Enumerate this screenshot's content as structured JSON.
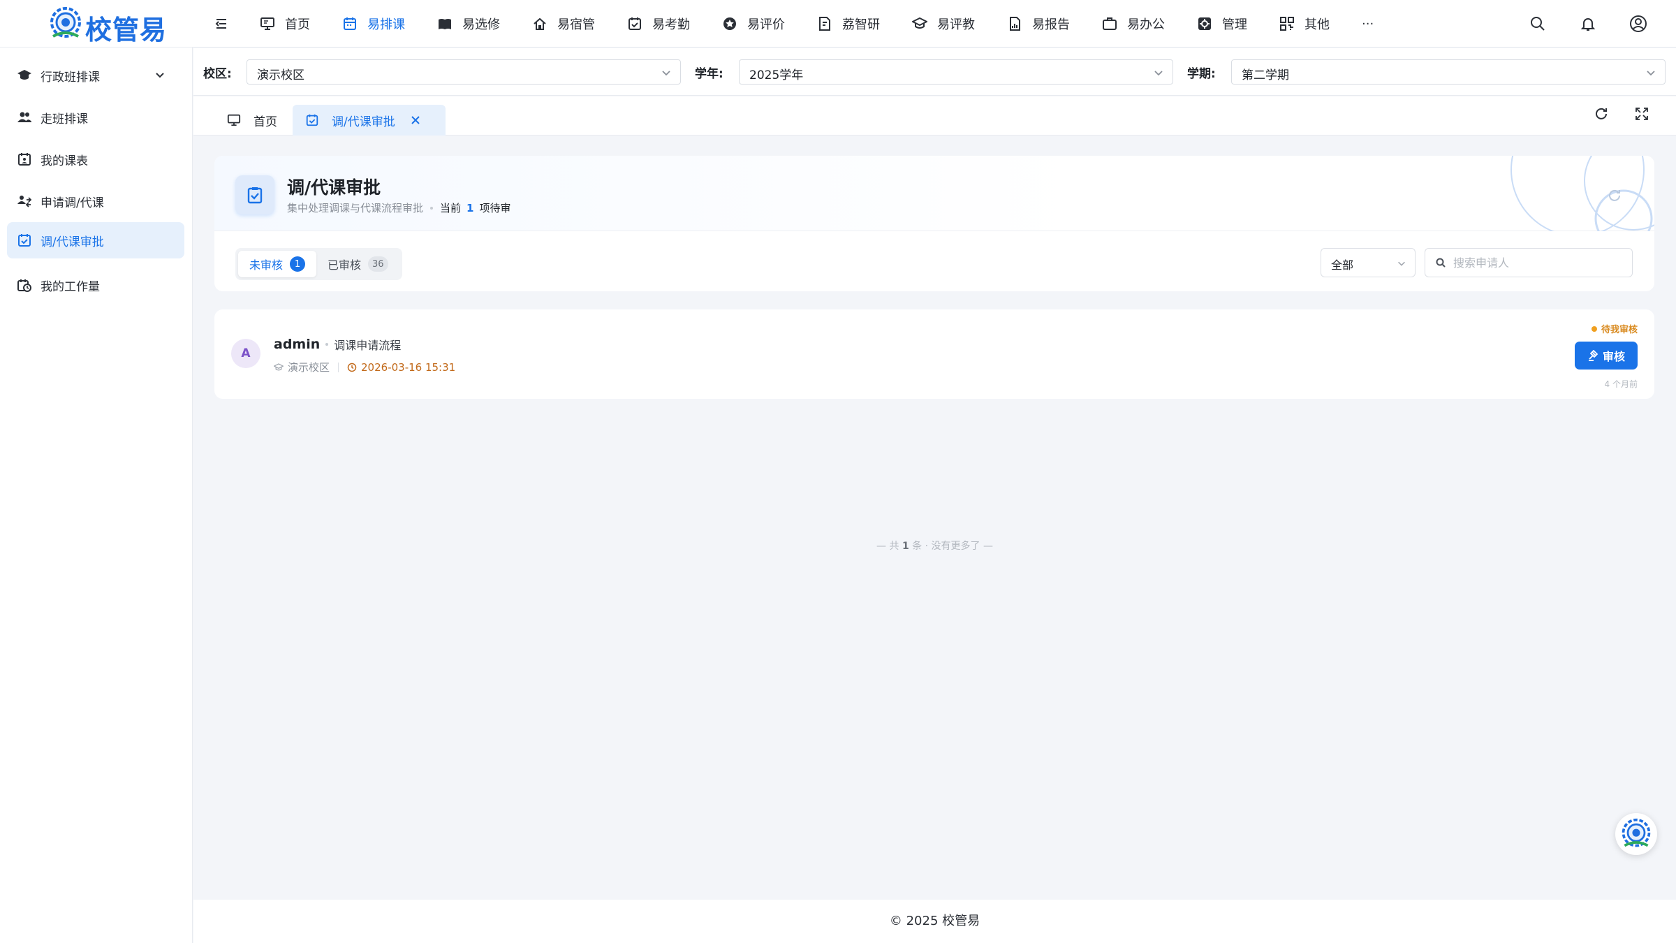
{
  "app": {
    "logo_text": "校管易"
  },
  "topnav": [
    {
      "label": "首页",
      "icon": "monitor-icon"
    },
    {
      "label": "易排课",
      "icon": "calendar-icon",
      "active": true
    },
    {
      "label": "易选修",
      "icon": "book-icon"
    },
    {
      "label": "易宿管",
      "icon": "house-icon"
    },
    {
      "label": "易考勤",
      "icon": "calendar-check-icon"
    },
    {
      "label": "易评价",
      "icon": "star-icon"
    },
    {
      "label": "荔智研",
      "icon": "document-icon"
    },
    {
      "label": "易评教",
      "icon": "graduation-cap-icon"
    },
    {
      "label": "易报告",
      "icon": "report-icon"
    },
    {
      "label": "易办公",
      "icon": "briefcase-icon"
    },
    {
      "label": "管理",
      "icon": "settings-icon"
    },
    {
      "label": "其他",
      "icon": "apps-icon"
    },
    {
      "label": "···",
      "icon": "more-icon"
    }
  ],
  "sidebar": {
    "items": [
      {
        "label": "行政班排课",
        "icon": "graduation-cap-icon"
      },
      {
        "label": "走班排课",
        "icon": "users-icon"
      },
      {
        "label": "我的课表",
        "icon": "calendar-person-icon"
      },
      {
        "label": "申请调/代课",
        "icon": "swap-users-icon"
      },
      {
        "label": "调/代课审批",
        "icon": "calendar-check-icon",
        "active": true
      },
      {
        "label": "我的工作量",
        "icon": "workload-icon"
      }
    ]
  },
  "filters": {
    "campus_label": "校区:",
    "campus_value": "演示校区",
    "year_label": "学年:",
    "year_value": "2025学年",
    "term_label": "学期:",
    "term_value": "第二学期"
  },
  "tabs": [
    {
      "label": "首页"
    },
    {
      "label": "调/代课审批",
      "active": true
    }
  ],
  "header": {
    "title": "调/代课审批",
    "subtitle": "集中处理调课与代课流程审批",
    "current_prefix": "当前",
    "pending_count": "1",
    "current_suffix": "项待审"
  },
  "segments": {
    "unreviewed_label": "未审核",
    "unreviewed_count": "1",
    "reviewed_label": "已审核",
    "reviewed_count": "36"
  },
  "filter_select": {
    "value": "全部"
  },
  "search": {
    "placeholder": "搜索申请人"
  },
  "records": [
    {
      "avatar": "A",
      "applicant": "admin",
      "flow": "调课申请流程",
      "campus": "演示校区",
      "time": "2026-03-16 15:31",
      "status": "待我审核",
      "action": "审核",
      "ago": "4 个月前"
    }
  ],
  "list_end": {
    "prefix": "— 共",
    "count": "1",
    "suffix": "条 · 没有更多了 —"
  },
  "footer": {
    "text": "© 2025 校管易"
  },
  "colors": {
    "accent": "#1a73e8",
    "warning": "#d98a1f"
  }
}
